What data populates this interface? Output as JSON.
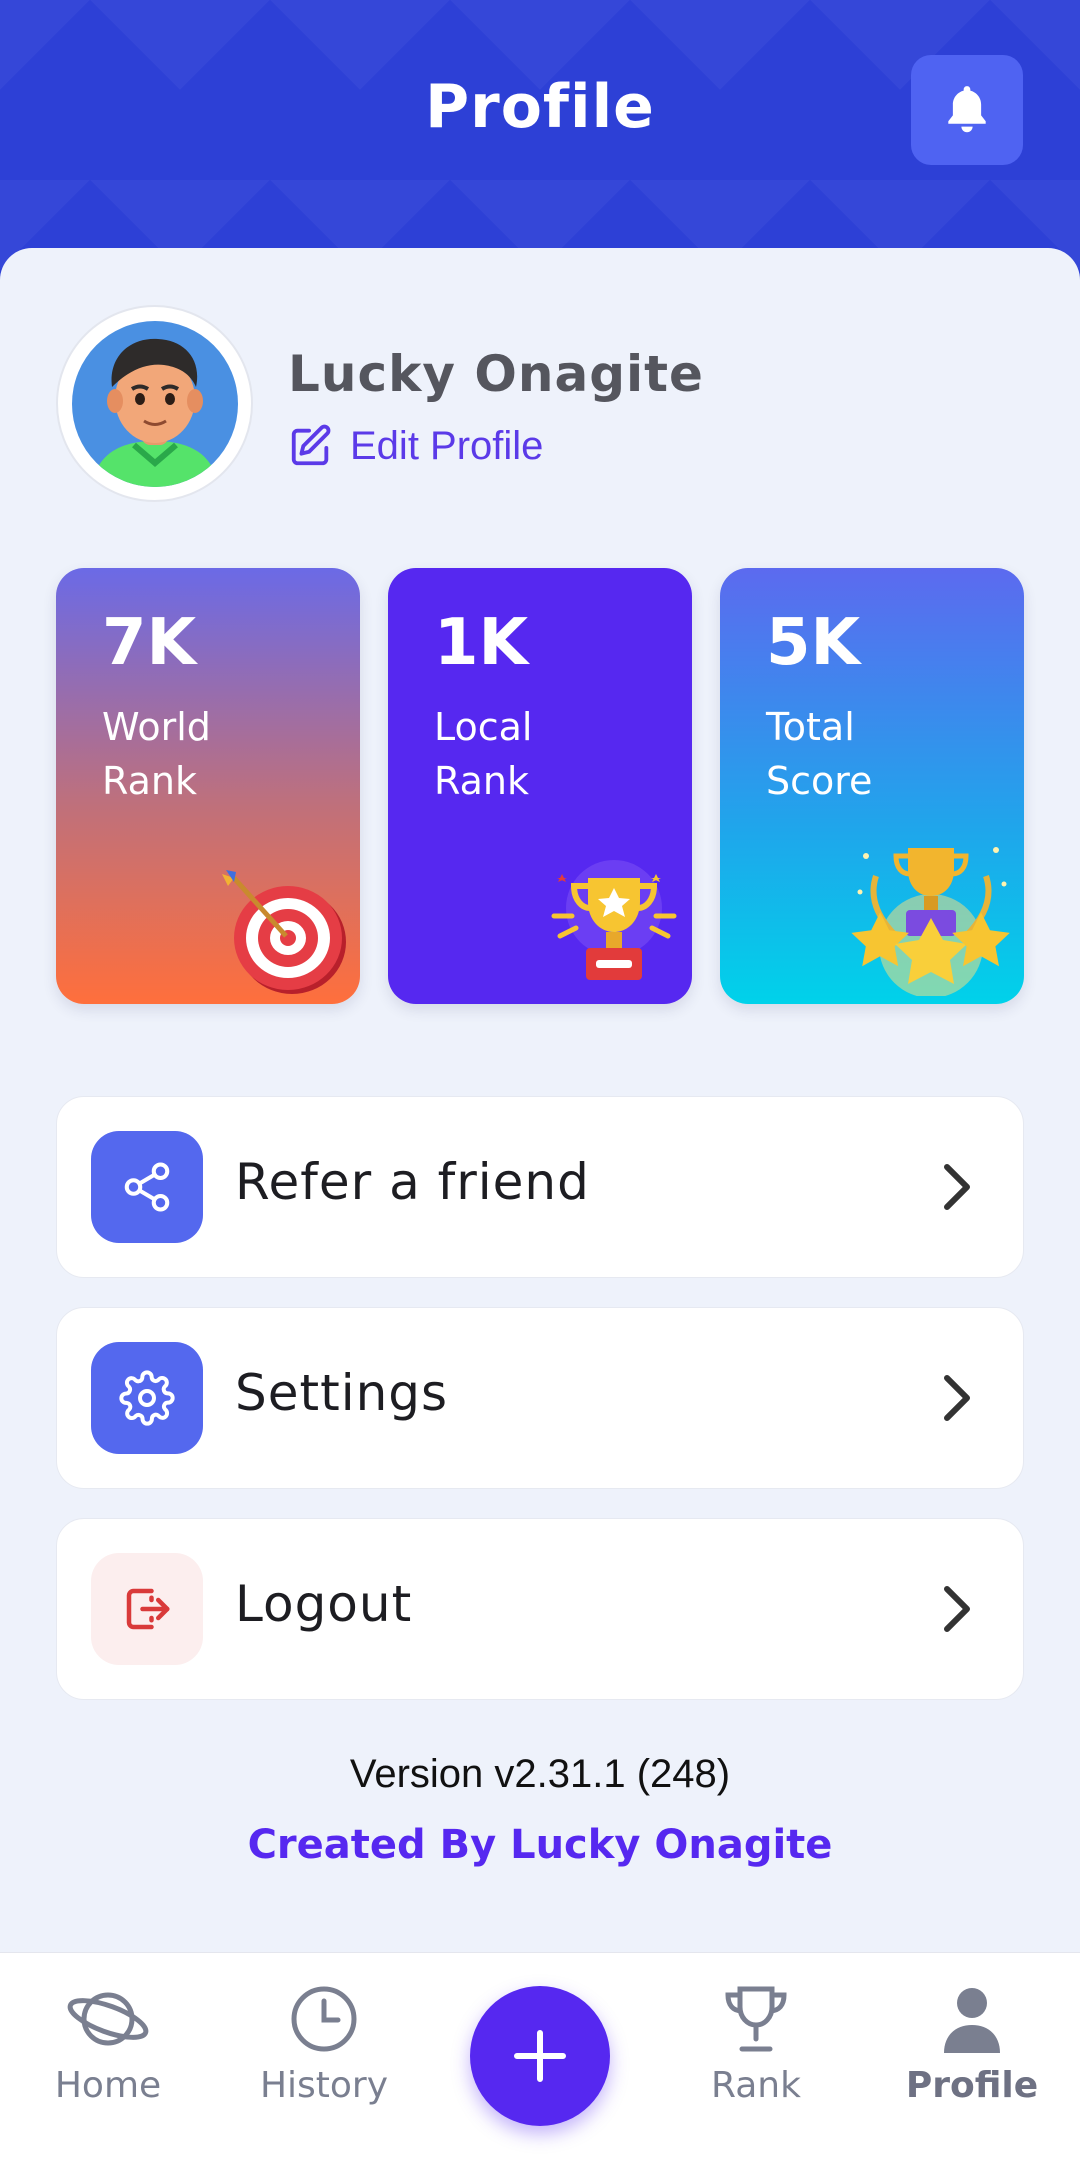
{
  "header": {
    "title": "Profile",
    "bell_icon": "bell-icon"
  },
  "profile": {
    "name": "Lucky Onagite",
    "edit_label": "Edit Profile",
    "edit_icon": "edit-icon"
  },
  "stats": [
    {
      "value": "7K",
      "label": "World Rank",
      "art": "target-dart-icon"
    },
    {
      "value": "1K",
      "label": "Local Rank",
      "art": "trophy-icon"
    },
    {
      "value": "5K",
      "label": "Total Score",
      "art": "trophy-stars-icon"
    }
  ],
  "menu": [
    {
      "label": "Refer a friend",
      "icon": "share-icon"
    },
    {
      "label": "Settings",
      "icon": "gear-icon"
    },
    {
      "label": "Logout",
      "icon": "logout-icon"
    }
  ],
  "footer": {
    "version": "Version v2.31.1 (248)",
    "credit": "Created By Lucky Onagite"
  },
  "nav": {
    "items": [
      {
        "label": "Home",
        "icon": "planet-icon"
      },
      {
        "label": "History",
        "icon": "clock-icon"
      },
      {
        "label": "Rank",
        "icon": "trophy-icon"
      },
      {
        "label": "Profile",
        "icon": "user-icon"
      }
    ],
    "active": "Profile",
    "fab_icon": "plus-icon"
  },
  "colors": {
    "primary": "#5628F0",
    "header": "#2D40D6",
    "accent_blue": "#4F63F2",
    "logout_red": "#D93A3A"
  }
}
